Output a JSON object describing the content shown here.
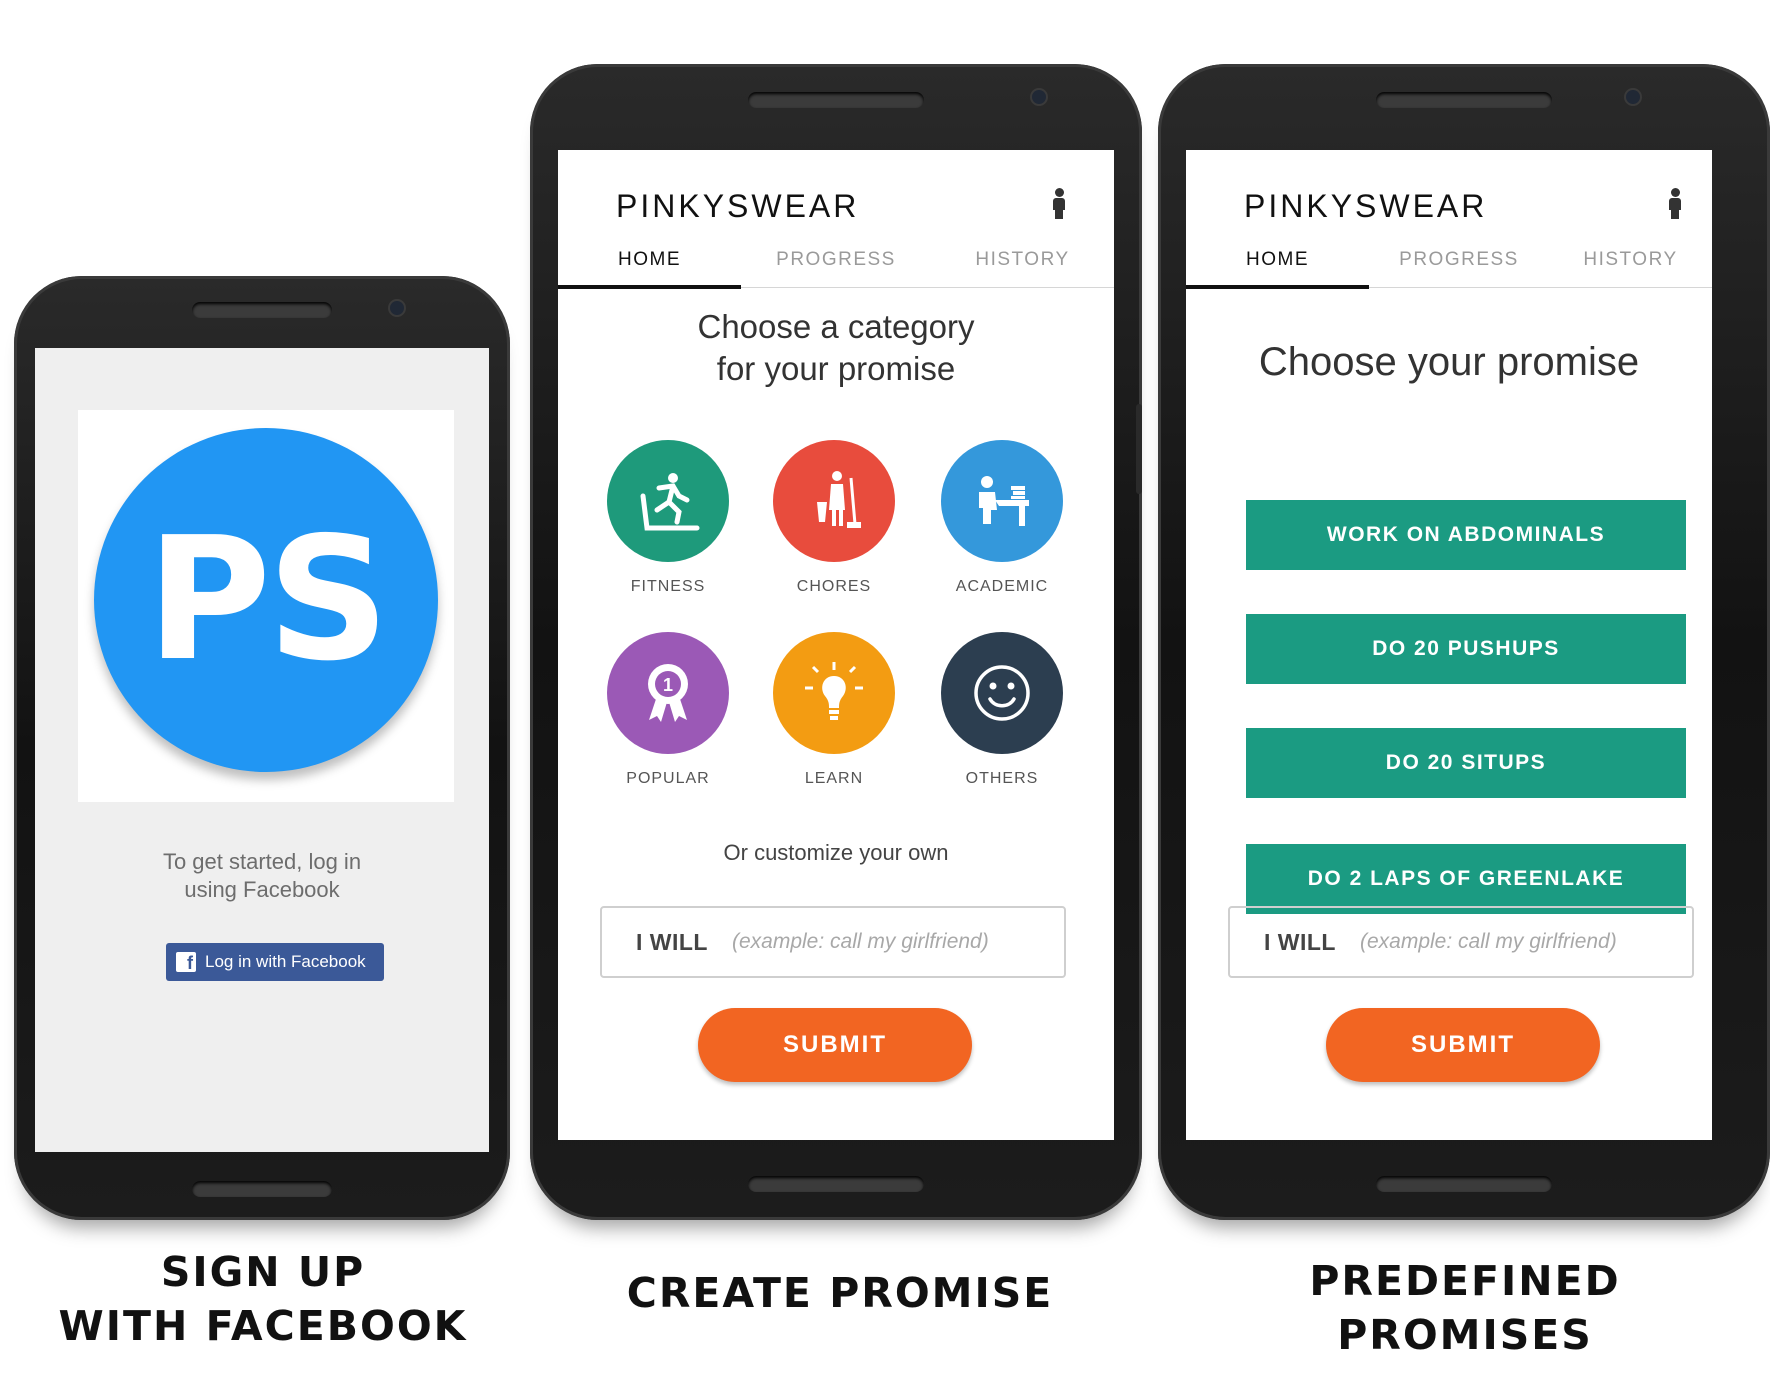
{
  "signup_screen": {
    "logo_text": "PS",
    "intro_line1": "To get started, log in",
    "intro_line2": "using Facebook",
    "facebook_button_icon": "f",
    "facebook_button_label": "Log in with Facebook"
  },
  "app": {
    "title": "PINKYSWEAR",
    "tabs": [
      "HOME",
      "PROGRESS",
      "HISTORY"
    ],
    "active_tab": "HOME",
    "profile_icon": "person-icon"
  },
  "create_promise_screen": {
    "heading_line1": "Choose a category",
    "heading_line2": "for your promise",
    "categories": [
      {
        "label": "FITNESS",
        "icon": "running-treadmill-icon",
        "color": "#1e9a7b"
      },
      {
        "label": "CHORES",
        "icon": "cleaning-icon",
        "color": "#e84c3d"
      },
      {
        "label": "ACADEMIC",
        "icon": "student-desk-icon",
        "color": "#3498db"
      },
      {
        "label": "POPULAR",
        "icon": "award-ribbon-icon",
        "color": "#9b59b6"
      },
      {
        "label": "LEARN",
        "icon": "lightbulb-icon",
        "color": "#f39c12"
      },
      {
        "label": "OTHERS",
        "icon": "smiley-icon",
        "color": "#2c3e50"
      }
    ],
    "customize_text": "Or customize your own",
    "will_label": "I WILL",
    "will_placeholder": "(example: call my girlfriend)",
    "submit_label": "SUBMIT"
  },
  "predefined_screen": {
    "heading": "Choose your promise",
    "promises": [
      "WORK ON ABDOMINALS",
      "DO 20 PUSHUPS",
      "DO 20 SITUPS",
      "DO 2 LAPS OF GREENLAKE"
    ],
    "will_label": "I WILL",
    "will_placeholder": "(example: call my girlfriend)",
    "submit_label": "SUBMIT"
  },
  "captions": {
    "signup_line1": "SIGN UP",
    "signup_line2": "WITH FACEBOOK",
    "create": "CREATE PROMISE",
    "predefined_line1": "PREDEFINED",
    "predefined_line2": "PROMISES"
  },
  "colors": {
    "brand_blue": "#2196f3",
    "facebook_blue": "#3b5998",
    "promise_green": "#1b9b82",
    "submit_orange": "#f26522"
  }
}
